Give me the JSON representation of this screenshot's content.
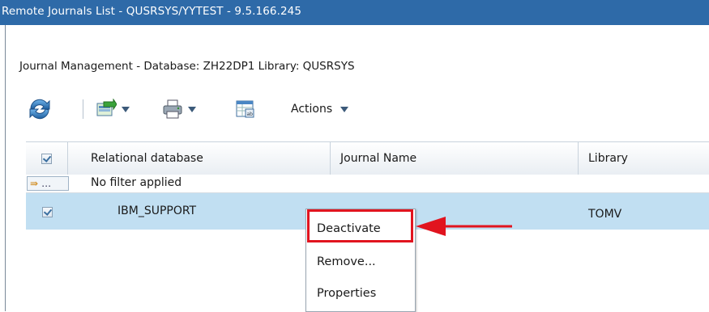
{
  "window": {
    "title": "Remote Journals List - QUSRSYS/YYTEST - 9.5.166.245"
  },
  "page": {
    "subtitle": "Journal Management - Database: ZH22DP1 Library: QUSRSYS"
  },
  "toolbar": {
    "icons": [
      "refresh-icon",
      "export-icon",
      "print-icon",
      "table-settings-icon"
    ],
    "actions_label": "Actions"
  },
  "table": {
    "columns": [
      "Relational database",
      "Journal Name",
      "Library"
    ],
    "filter_button": "…",
    "filter_text": "No filter applied",
    "rows": [
      {
        "selected": true,
        "relational_database": "IBM_SUPPORT",
        "journal_name": "",
        "library": "TOMV"
      }
    ]
  },
  "context_menu": {
    "items": [
      "Deactivate",
      "Remove...",
      "Properties"
    ],
    "highlighted_item": "Deactivate"
  },
  "colors": {
    "titlebar": "#2e6aa8",
    "selected_row": "#c1dff2",
    "callout": "#e1141f"
  }
}
